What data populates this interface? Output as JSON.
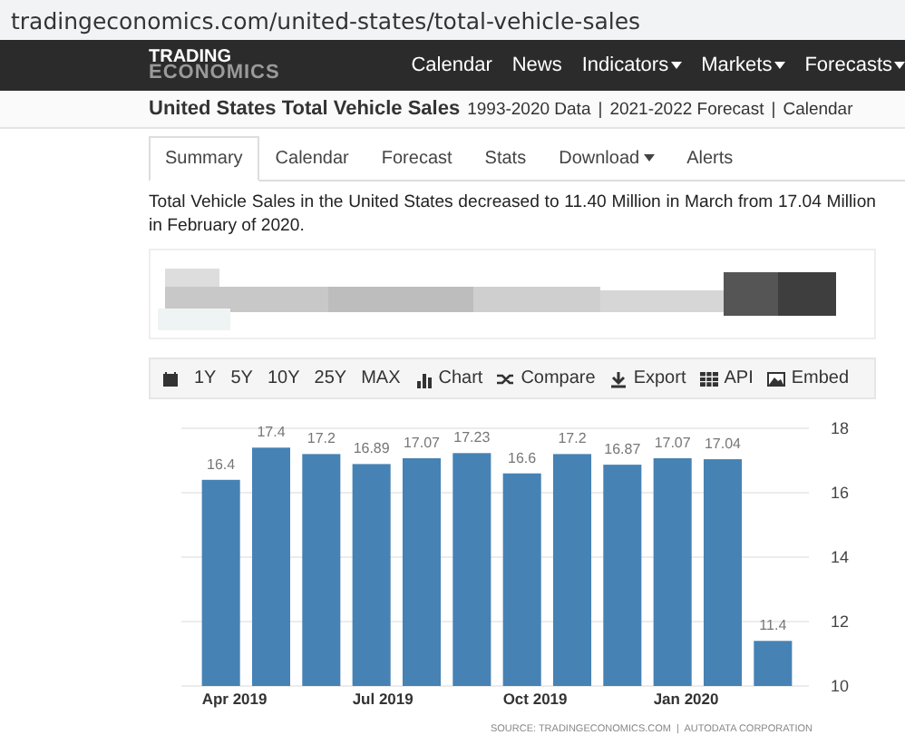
{
  "address_bar": {
    "url": "tradingeconomics.com/united-states/total-vehicle-sales"
  },
  "nav": {
    "logo": {
      "line1": "TRADING",
      "line2": "ECONOMICS"
    },
    "items": [
      {
        "label": "Calendar",
        "dropdown": false
      },
      {
        "label": "News",
        "dropdown": false
      },
      {
        "label": "Indicators",
        "dropdown": true
      },
      {
        "label": "Markets",
        "dropdown": true
      },
      {
        "label": "Forecasts",
        "dropdown": true
      }
    ]
  },
  "heading": {
    "title": "United States Total Vehicle Sales",
    "separator": "|",
    "links": [
      "1993-2020 Data",
      "2021-2022 Forecast",
      "Calendar"
    ]
  },
  "tabs": [
    {
      "label": "Summary",
      "selected": true,
      "dropdown": false
    },
    {
      "label": "Calendar",
      "selected": false,
      "dropdown": false
    },
    {
      "label": "Forecast",
      "selected": false,
      "dropdown": false
    },
    {
      "label": "Stats",
      "selected": false,
      "dropdown": false
    },
    {
      "label": "Download",
      "selected": false,
      "dropdown": true
    },
    {
      "label": "Alerts",
      "selected": false,
      "dropdown": false
    }
  ],
  "summary": "Total Vehicle Sales in the United States decreased to 11.40 Million in March from 17.04 Million in February of 2020.",
  "toolbar": [
    {
      "kind": "calendar"
    },
    {
      "kind": "range",
      "label": "1Y"
    },
    {
      "kind": "range",
      "label": "5Y"
    },
    {
      "kind": "range",
      "label": "10Y"
    },
    {
      "kind": "range",
      "label": "25Y"
    },
    {
      "kind": "range",
      "label": "MAX"
    },
    {
      "kind": "chart",
      "label": "Chart"
    },
    {
      "kind": "compare",
      "label": "Compare"
    },
    {
      "kind": "export",
      "label": "Export"
    },
    {
      "kind": "api",
      "label": "API"
    },
    {
      "kind": "embed",
      "label": "Embed"
    }
  ],
  "chart": {
    "source": "SOURCE: TRADINGECONOMICS.COM  |  AUTODATA CORPORATION",
    "chart_data": {
      "type": "bar",
      "data_labels": true,
      "ylim": [
        10,
        18
      ],
      "yticks": [
        10,
        12,
        14,
        16,
        18
      ],
      "grid": true,
      "categories": [
        "Apr 2019",
        null,
        null,
        "Jul 2019",
        null,
        null,
        "Oct 2019",
        null,
        null,
        "Jan 2020",
        null,
        null
      ],
      "series": [
        {
          "color": "#4682b4",
          "values": [
            16.4,
            17.4,
            17.2,
            16.89,
            17.07,
            17.23,
            16.6,
            17.2,
            16.87,
            17.07,
            17.04,
            11.4
          ]
        }
      ]
    }
  }
}
